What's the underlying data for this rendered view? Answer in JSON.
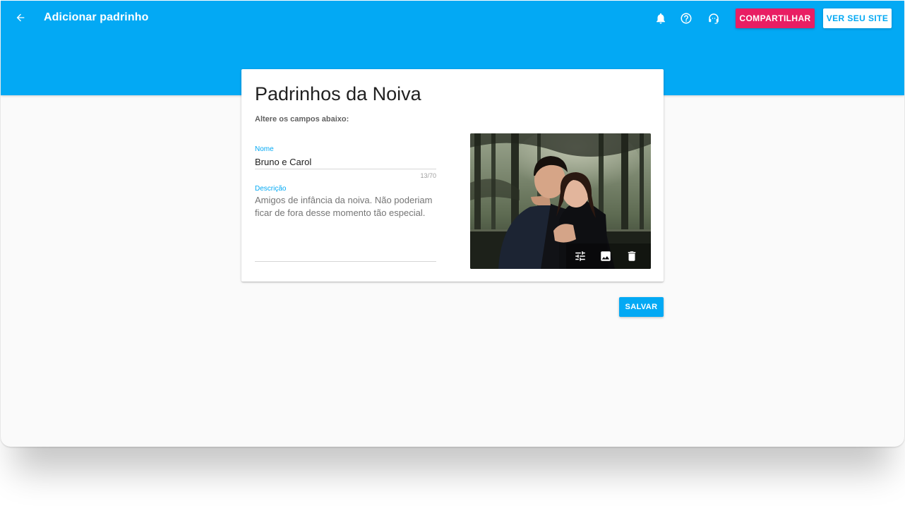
{
  "header": {
    "title": "Adicionar padrinho",
    "share_label": "COMPARTILHAR",
    "view_site_label": "VER SEU SITE",
    "icons": [
      "arrow-back-icon",
      "bell-icon",
      "help-icon",
      "support-headset-icon"
    ]
  },
  "card": {
    "title": "Padrinhos da Noiva",
    "subtitle": "Altere os campos abaixo:",
    "name_field": {
      "label": "Nome",
      "value": "Bruno e Carol",
      "counter": "13/70"
    },
    "description_field": {
      "label": "Descrição",
      "placeholder": "Amigos de infância da noiva. Não poderiam ficar de fora desse momento tão especial."
    },
    "photo_tools": [
      "tune-icon",
      "image-icon",
      "delete-icon"
    ]
  },
  "actions": {
    "save_label": "SALVAR"
  },
  "colors": {
    "primary": "#03a9f4",
    "accent": "#e91e63",
    "background": "#fafafa"
  }
}
